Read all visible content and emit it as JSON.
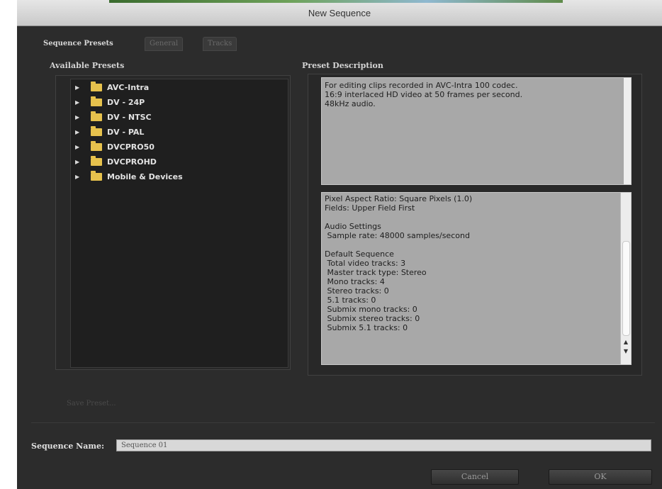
{
  "window": {
    "title": "New Sequence"
  },
  "tabs": [
    {
      "label": "Sequence Presets",
      "active": true
    },
    {
      "label": "General",
      "active": false
    },
    {
      "label": "Tracks",
      "active": false
    }
  ],
  "presets": {
    "label": "Available Presets",
    "items": [
      {
        "label": "AVC-Intra",
        "icon": "folder-icon"
      },
      {
        "label": "DV - 24P",
        "icon": "folder-icon"
      },
      {
        "label": "DV - NTSC",
        "icon": "folder-icon"
      },
      {
        "label": "DV - PAL",
        "icon": "folder-icon"
      },
      {
        "label": "DVCPRO50",
        "icon": "folder-icon"
      },
      {
        "label": "DVCPROHD",
        "icon": "folder-icon"
      },
      {
        "label": "Mobile & Devices",
        "icon": "folder-icon"
      }
    ]
  },
  "description": {
    "label": "Preset Description",
    "lines": [
      "For editing clips recorded in AVC-Intra 100 codec.",
      "16:9 interlaced HD video at 50 frames per second.",
      "48kHz audio."
    ]
  },
  "details": {
    "lines": [
      "Pixel Aspect Ratio: Square Pixels (1.0)",
      "Fields: Upper Field First",
      "",
      "Audio Settings",
      " Sample rate: 48000 samples/second",
      "",
      "Default Sequence",
      " Total video tracks: 3",
      " Master track type: Stereo",
      " Mono tracks: 4",
      " Stereo tracks: 0",
      " 5.1 tracks: 0",
      " Submix mono tracks: 0",
      " Submix stereo tracks: 0",
      " Submix 5.1 tracks: 0"
    ]
  },
  "save_preset": {
    "label": "Save Preset..."
  },
  "sequence_name": {
    "label": "Sequence Name:",
    "value": "Sequence 01"
  },
  "buttons": {
    "cancel": "Cancel",
    "ok": "OK"
  }
}
